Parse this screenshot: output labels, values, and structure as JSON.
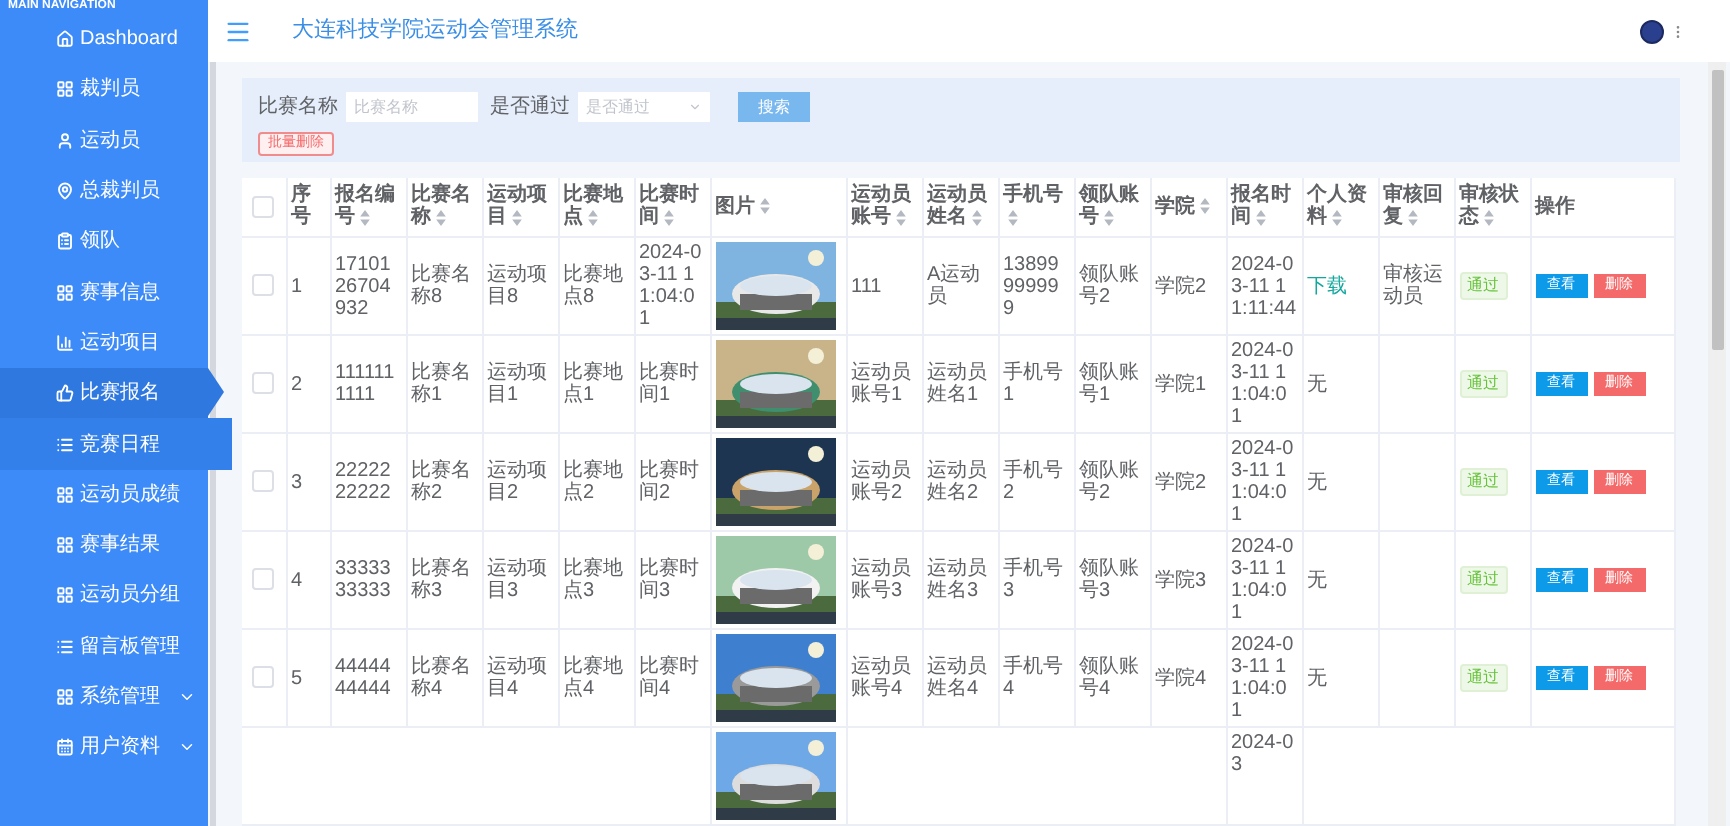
{
  "sidebar": {
    "heading": "MAIN NAVIGATION",
    "items": [
      {
        "label": "Dashboard",
        "selected": false,
        "hovered": false,
        "expandable": false
      },
      {
        "label": "裁判员",
        "selected": false,
        "hovered": false,
        "expandable": false
      },
      {
        "label": "运动员",
        "selected": false,
        "hovered": false,
        "expandable": false
      },
      {
        "label": "总裁判员",
        "selected": false,
        "hovered": false,
        "expandable": false
      },
      {
        "label": "领队",
        "selected": false,
        "hovered": false,
        "expandable": false
      },
      {
        "label": "赛事信息",
        "selected": false,
        "hovered": false,
        "expandable": false
      },
      {
        "label": "运动项目",
        "selected": false,
        "hovered": false,
        "expandable": false
      },
      {
        "label": "比赛报名",
        "selected": true,
        "hovered": false,
        "expandable": false
      },
      {
        "label": "竞赛日程",
        "selected": false,
        "hovered": true,
        "expandable": false
      },
      {
        "label": "运动员成绩",
        "selected": false,
        "hovered": false,
        "expandable": false
      },
      {
        "label": "赛事结果",
        "selected": false,
        "hovered": false,
        "expandable": false
      },
      {
        "label": "运动员分组",
        "selected": false,
        "hovered": false,
        "expandable": false
      },
      {
        "label": "留言板管理",
        "selected": false,
        "hovered": false,
        "expandable": false
      },
      {
        "label": "系统管理",
        "selected": false,
        "hovered": false,
        "expandable": true
      },
      {
        "label": "用户资料",
        "selected": false,
        "hovered": false,
        "expandable": true
      }
    ]
  },
  "header": {
    "title": "大连科技学院运动会管理系统"
  },
  "search": {
    "fields": [
      {
        "kind": "input",
        "label": "比赛名称",
        "placeholder": "比赛名称"
      },
      {
        "kind": "select",
        "label": "是否通过",
        "placeholder": "是否通过"
      }
    ],
    "search_button": "搜索",
    "batch_delete_button": "批量删除"
  },
  "table": {
    "select_all": {
      "checked": false
    },
    "columns": [
      {
        "label": "序号",
        "sortable": false
      },
      {
        "label": "报名编号",
        "sortable": true
      },
      {
        "label": "比赛名称",
        "sortable": true
      },
      {
        "label": "运动项目",
        "sortable": true
      },
      {
        "label": "比赛地点",
        "sortable": true
      },
      {
        "label": "比赛时间",
        "sortable": true
      },
      {
        "label": "图片",
        "sortable": true
      },
      {
        "label": "运动员账号",
        "sortable": true
      },
      {
        "label": "运动员姓名",
        "sortable": true
      },
      {
        "label": "手机号",
        "sortable": true
      },
      {
        "label": "领队账号",
        "sortable": true
      },
      {
        "label": "学院",
        "sortable": true
      },
      {
        "label": "报名时间",
        "sortable": true
      },
      {
        "label": "个人资料",
        "sortable": true
      },
      {
        "label": "审核回复",
        "sortable": true
      },
      {
        "label": "审核状态",
        "sortable": true
      },
      {
        "label": "操作",
        "sortable": false
      }
    ],
    "rows": [
      {
        "checked": false,
        "no": "1",
        "reg_no": "1710126704932",
        "match_name": "比赛名称8",
        "event": "运动项目8",
        "venue": "比赛地点8",
        "match_time": "2024-03-11 11:04:01",
        "account": "111",
        "athlete_name": "A运动员",
        "phone": "13899999999",
        "leader": "领队账号2",
        "college": "学院2",
        "reg_time": "2024-03-11 11:11:44",
        "file": {
          "kind": "link",
          "text": "下载"
        },
        "reply": "审核运动员",
        "status": "通过",
        "actions": [
          "查看",
          "删除"
        ]
      },
      {
        "checked": false,
        "no": "2",
        "reg_no": "1111111111",
        "match_name": "比赛名称1",
        "event": "运动项目1",
        "venue": "比赛地点1",
        "match_time": "比赛时间1",
        "account": "运动员账号1",
        "athlete_name": "运动员姓名1",
        "phone": "手机号1",
        "leader": "领队账号1",
        "college": "学院1",
        "reg_time": "2024-03-11 11:04:01",
        "file": {
          "kind": "text",
          "text": "无"
        },
        "status": "通过",
        "actions": [
          "查看",
          "删除"
        ]
      },
      {
        "checked": false,
        "no": "3",
        "reg_no": "2222222222",
        "match_name": "比赛名称2",
        "event": "运动项目2",
        "venue": "比赛地点2",
        "match_time": "比赛时间2",
        "account": "运动员账号2",
        "athlete_name": "运动员姓名2",
        "phone": "手机号2",
        "leader": "领队账号2",
        "college": "学院2",
        "reg_time": "2024-03-11 11:04:01",
        "file": {
          "kind": "text",
          "text": "无"
        },
        "status": "通过",
        "actions": [
          "查看",
          "删除"
        ]
      },
      {
        "checked": false,
        "no": "4",
        "reg_no": "3333333333",
        "match_name": "比赛名称3",
        "event": "运动项目3",
        "venue": "比赛地点3",
        "match_time": "比赛时间3",
        "account": "运动员账号3",
        "athlete_name": "运动员姓名3",
        "phone": "手机号3",
        "leader": "领队账号3",
        "college": "学院3",
        "reg_time": "2024-03-11 11:04:01",
        "file": {
          "kind": "text",
          "text": "无"
        },
        "status": "通过",
        "actions": [
          "查看",
          "删除"
        ]
      },
      {
        "checked": false,
        "no": "5",
        "reg_no": "4444444444",
        "match_name": "比赛名称4",
        "event": "运动项目4",
        "venue": "比赛地点4",
        "match_time": "比赛时间4",
        "account": "运动员账号4",
        "athlete_name": "运动员姓名4",
        "phone": "手机号4",
        "leader": "领队账号4",
        "college": "学院4",
        "reg_time": "2024-03-11 11:04:01",
        "file": {
          "kind": "text",
          "text": "无"
        },
        "status": "通过",
        "actions": [
          "查看",
          "删除"
        ]
      }
    ],
    "partial_row": {
      "reg_time": "2024-03"
    }
  }
}
